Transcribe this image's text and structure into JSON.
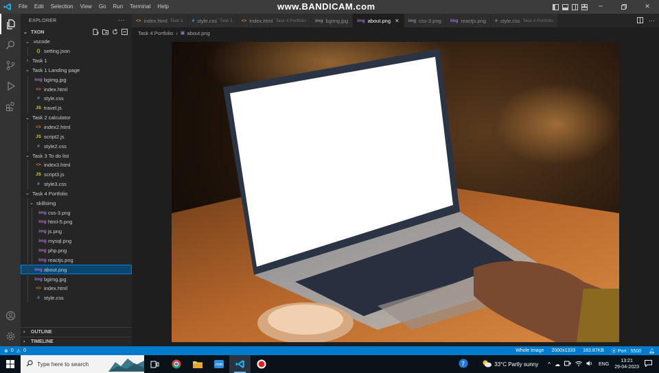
{
  "titlebar": {
    "menu": [
      "File",
      "Edit",
      "Selection",
      "View",
      "Go",
      "Run",
      "Terminal",
      "Help"
    ],
    "watermark": "www.BANDICAM.com"
  },
  "sidebar": {
    "header": "EXPLORER",
    "root": "TXON",
    "tree": [
      {
        "label": ".vscode",
        "type": "folder",
        "open": true,
        "depth": 0
      },
      {
        "label": "setting.json",
        "type": "json",
        "depth": 1
      },
      {
        "label": "Task 1",
        "type": "folder",
        "open": false,
        "depth": 0
      },
      {
        "label": "Task 1 Landing page",
        "type": "folder",
        "open": true,
        "depth": 0
      },
      {
        "label": "bgimg.jpg",
        "type": "img",
        "depth": 1
      },
      {
        "label": "index.html",
        "type": "html",
        "depth": 1
      },
      {
        "label": "style.css",
        "type": "css",
        "depth": 1
      },
      {
        "label": "travel.js",
        "type": "js",
        "depth": 1
      },
      {
        "label": "Task 2 calculator",
        "type": "folder",
        "open": true,
        "depth": 0
      },
      {
        "label": "index2.html",
        "type": "html",
        "depth": 1
      },
      {
        "label": "script2.js",
        "type": "js",
        "depth": 1
      },
      {
        "label": "style2.css",
        "type": "css",
        "depth": 1
      },
      {
        "label": "Task 3 To do list",
        "type": "folder",
        "open": true,
        "depth": 0
      },
      {
        "label": "index3.html",
        "type": "html",
        "depth": 1
      },
      {
        "label": "script3.js",
        "type": "js",
        "depth": 1
      },
      {
        "label": "style3.css",
        "type": "css",
        "depth": 1
      },
      {
        "label": "Task 4 Portfolio",
        "type": "folder",
        "open": true,
        "depth": 0
      },
      {
        "label": "skillsimg",
        "type": "folder",
        "open": true,
        "depth": 1
      },
      {
        "label": "css-3.png",
        "type": "img",
        "depth": 2
      },
      {
        "label": "html-5.png",
        "type": "img",
        "depth": 2
      },
      {
        "label": "js.png",
        "type": "img",
        "depth": 2
      },
      {
        "label": "mysql.png",
        "type": "img",
        "depth": 2
      },
      {
        "label": "php.png",
        "type": "img",
        "depth": 2
      },
      {
        "label": "reactjs.png",
        "type": "img",
        "depth": 2
      },
      {
        "label": "about.png",
        "type": "img",
        "depth": 1,
        "selected": true
      },
      {
        "label": "bgimg.jpg",
        "type": "img",
        "depth": 1
      },
      {
        "label": "index.html",
        "type": "html",
        "depth": 1
      },
      {
        "label": "style.css",
        "type": "css",
        "depth": 1
      }
    ],
    "outline": "OUTLINE",
    "timeline": "TIMELINE"
  },
  "tabs": [
    {
      "label": "index.html",
      "desc": "Task 1",
      "type": "html"
    },
    {
      "label": "style.css",
      "desc": "Task 1",
      "type": "css"
    },
    {
      "label": "index.html",
      "desc": "Task 4 Portfolio",
      "type": "html"
    },
    {
      "label": "bgimg.jpg",
      "desc": "",
      "type": "img"
    },
    {
      "label": "about.png",
      "desc": "",
      "type": "img",
      "active": true
    },
    {
      "label": "css-3.png",
      "desc": "",
      "type": "img"
    },
    {
      "label": "reactjs.png",
      "desc": "",
      "type": "img"
    },
    {
      "label": "style.css",
      "desc": "Task 4 Portfolio",
      "type": "css"
    }
  ],
  "breadcrumb": {
    "folder": "Task 4 Portfolio",
    "file": "about.png"
  },
  "icons": {
    "json": "{}",
    "html": "<>",
    "css": "#",
    "js": "JS",
    "img": "img"
  },
  "colors": {
    "accent": "#007acc",
    "selection": "#094771",
    "html": "#e37933",
    "css": "#519aba",
    "js": "#cbcb41",
    "json": "#cbcb41",
    "img": "#a074c4"
  },
  "statusbar": {
    "errors": "0",
    "warnings": "0",
    "image_mode": "Whole Image",
    "dimensions": "2000x1333",
    "size": "183.87KB",
    "port": "Port : 5500"
  },
  "taskbar": {
    "search_placeholder": "Type here to search",
    "weather": "33°C  Partly sunny",
    "lang": "ENG",
    "time": "13:21",
    "date": "29-04-2023"
  }
}
